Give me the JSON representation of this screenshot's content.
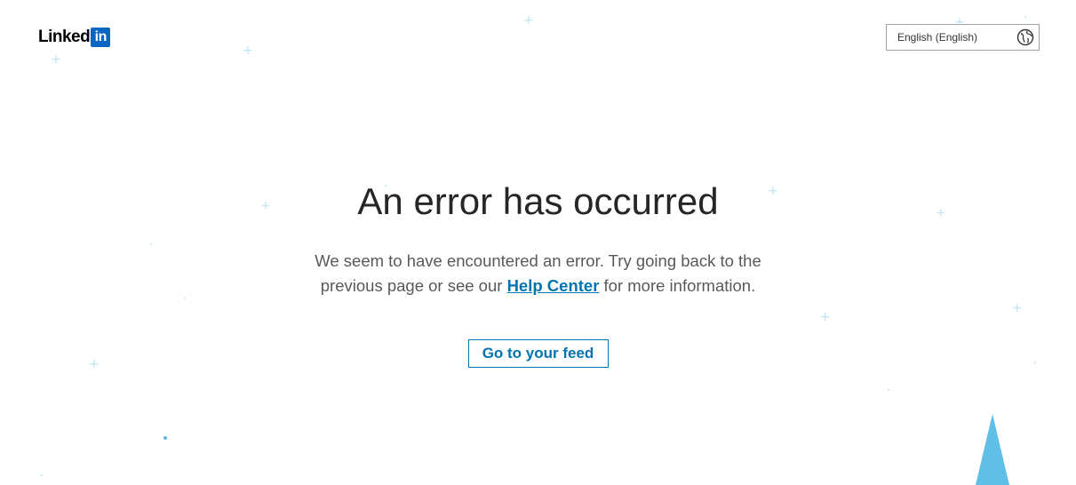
{
  "header": {
    "logo_word": "Linked",
    "logo_in": "in",
    "language_selector": {
      "label": "English (English)",
      "icon": "globe-icon"
    }
  },
  "main": {
    "title": "An error has occurred",
    "message_part1": "We seem to have encountered an error. Try going back to the previous page or see our ",
    "help_link_label": "Help Center",
    "message_part2": " for more information.",
    "feed_button_label": "Go to your feed"
  },
  "colors": {
    "brand_blue": "#0a66c2",
    "link_blue": "#0073b1",
    "decoration_blue": "#bfe4f5",
    "tree_blue": "#5fbfe6"
  }
}
